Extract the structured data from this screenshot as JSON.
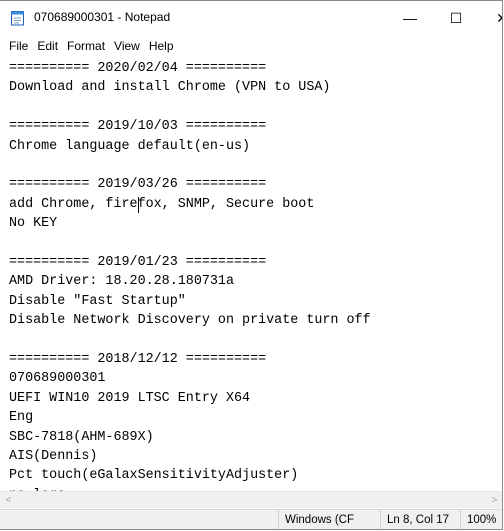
{
  "window": {
    "title": "070689000301 - Notepad",
    "minimize_glyph": "—",
    "maximize_glyph": "☐",
    "close_glyph": "✕",
    "app_icon": "notepad-icon"
  },
  "menu": [
    "File",
    "Edit",
    "Format",
    "View",
    "Help"
  ],
  "editor": {
    "lines": [
      "========== 2020/02/04 ==========",
      "Download and install Chrome (VPN to USA)",
      "",
      "========== 2019/10/03 ==========",
      "Chrome language default(en-us)",
      "",
      "========== 2019/03/26 ==========",
      "add Chrome, firefox, SNMP, Secure boot",
      "No KEY",
      "",
      "========== 2019/01/23 ==========",
      "AMD Driver: 18.20.28.180731a",
      "Disable \"Fast Startup\"",
      "Disable Network Discovery on private turn off",
      "",
      "========== 2018/12/12 ==========",
      "070689000301",
      "UEFI WIN10 2019 LTSC Entry X64",
      "Eng",
      "SBC-7818(AHM-689X)",
      "AIS(Dennis)",
      "Pct touch(eGalaxSensitivityAdjuster)",
      "no logo"
    ],
    "caret_line": 8,
    "caret_col": 17
  },
  "scrollbar": {
    "left_glyph": "<",
    "right_glyph": ">"
  },
  "status": {
    "encoding": "Windows (CF",
    "position": "Ln 8, Col 17",
    "zoom": "100%"
  }
}
